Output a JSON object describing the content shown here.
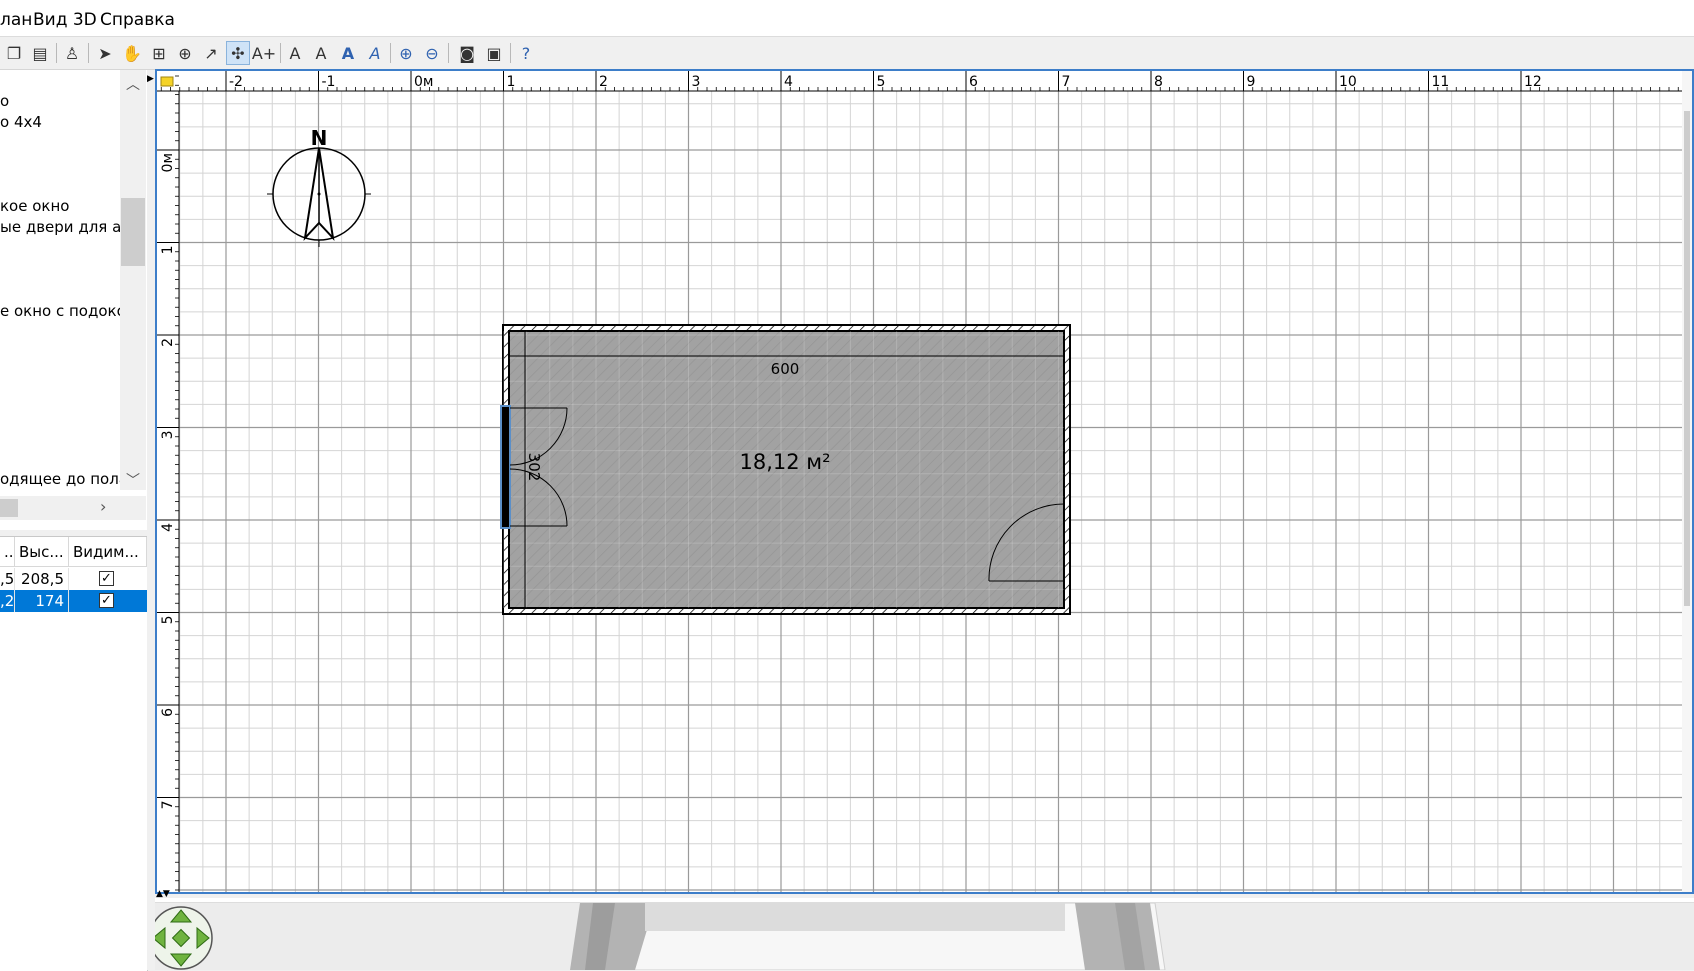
{
  "menu": {
    "plan": "лан",
    "view3d": "Вид 3D",
    "help": "Справка"
  },
  "catalog": {
    "items": [
      "о",
      "о 4x4",
      "кое окно",
      "ые двери для ава",
      "е окно с подокон",
      "одящее до пола"
    ]
  },
  "furniture_table": {
    "headers": [
      "...",
      "Выс...",
      "Видим..."
    ],
    "rows": [
      {
        "col1": ",5",
        "height": "208,5",
        "visible": true,
        "selected": false
      },
      {
        "col1": ",2",
        "height": "174",
        "visible": true,
        "selected": true
      }
    ]
  },
  "plan": {
    "ruler_x": [
      "-2",
      "-1",
      "0м",
      "1",
      "2",
      "3",
      "4",
      "5",
      "6",
      "7",
      "8",
      "9",
      "10",
      "11",
      "12"
    ],
    "ruler_y": [
      "0м",
      "1",
      "2",
      "3",
      "4",
      "5",
      "6",
      "7"
    ],
    "compass_label": "N",
    "room_area": "18,12 м²",
    "dim_width": "600",
    "dim_height": "302"
  },
  "colors": {
    "room_fill": "#9d9d9d",
    "selection": "#0078d7",
    "plan_border": "#3d7ec9"
  }
}
